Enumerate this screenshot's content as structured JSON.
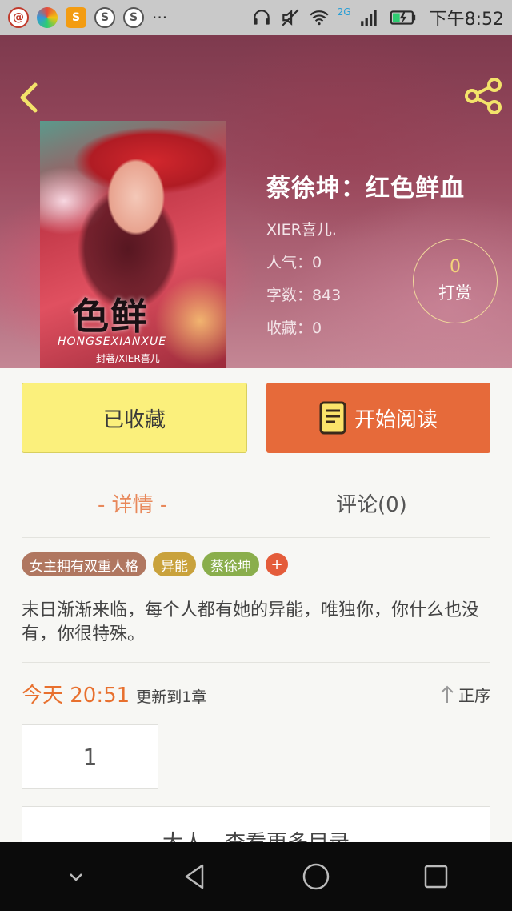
{
  "status_bar": {
    "time": "下午8:52",
    "network": "2G",
    "app_icons": [
      "mail-icon",
      "photos-icon",
      "s-app-icon",
      "s-app-icon",
      "s-app-icon"
    ],
    "more": "···"
  },
  "hero": {
    "title": "蔡徐坤：红色鲜血",
    "author": "XIER喜儿.",
    "popularity": "人气：0",
    "word_count": "字数：843",
    "favorites": "收藏：0",
    "tip_count": "0",
    "tip_label": "打赏",
    "cover_title": "色鲜",
    "cover_subtitle": "HONGSEXIANXUE",
    "cover_author": "封著/XIER喜儿"
  },
  "actions": {
    "favorited_label": "已收藏",
    "read_label": "开始阅读"
  },
  "tabs": {
    "details": "- 详情 -",
    "comments": "评论(0)"
  },
  "tags": [
    {
      "label": "女主拥有双重人格",
      "color": "#b07760"
    },
    {
      "label": "异能",
      "color": "#c9a23c"
    },
    {
      "label": "蔡徐坤",
      "color": "#8aae4c"
    }
  ],
  "tag_add": "+",
  "description": "末日渐渐来临，每个人都有她的异能，唯独你，你什么也没有，你很特殊。",
  "update": {
    "time": "今天 20:51",
    "text": "更新到1章",
    "order_label": "正序"
  },
  "chapters": [
    "1"
  ],
  "more_label": "大人，查看更多目录",
  "colors": {
    "accent_orange": "#e66a3a",
    "favorited_yellow": "#fbf07c",
    "active_tab": "#e8885a"
  }
}
